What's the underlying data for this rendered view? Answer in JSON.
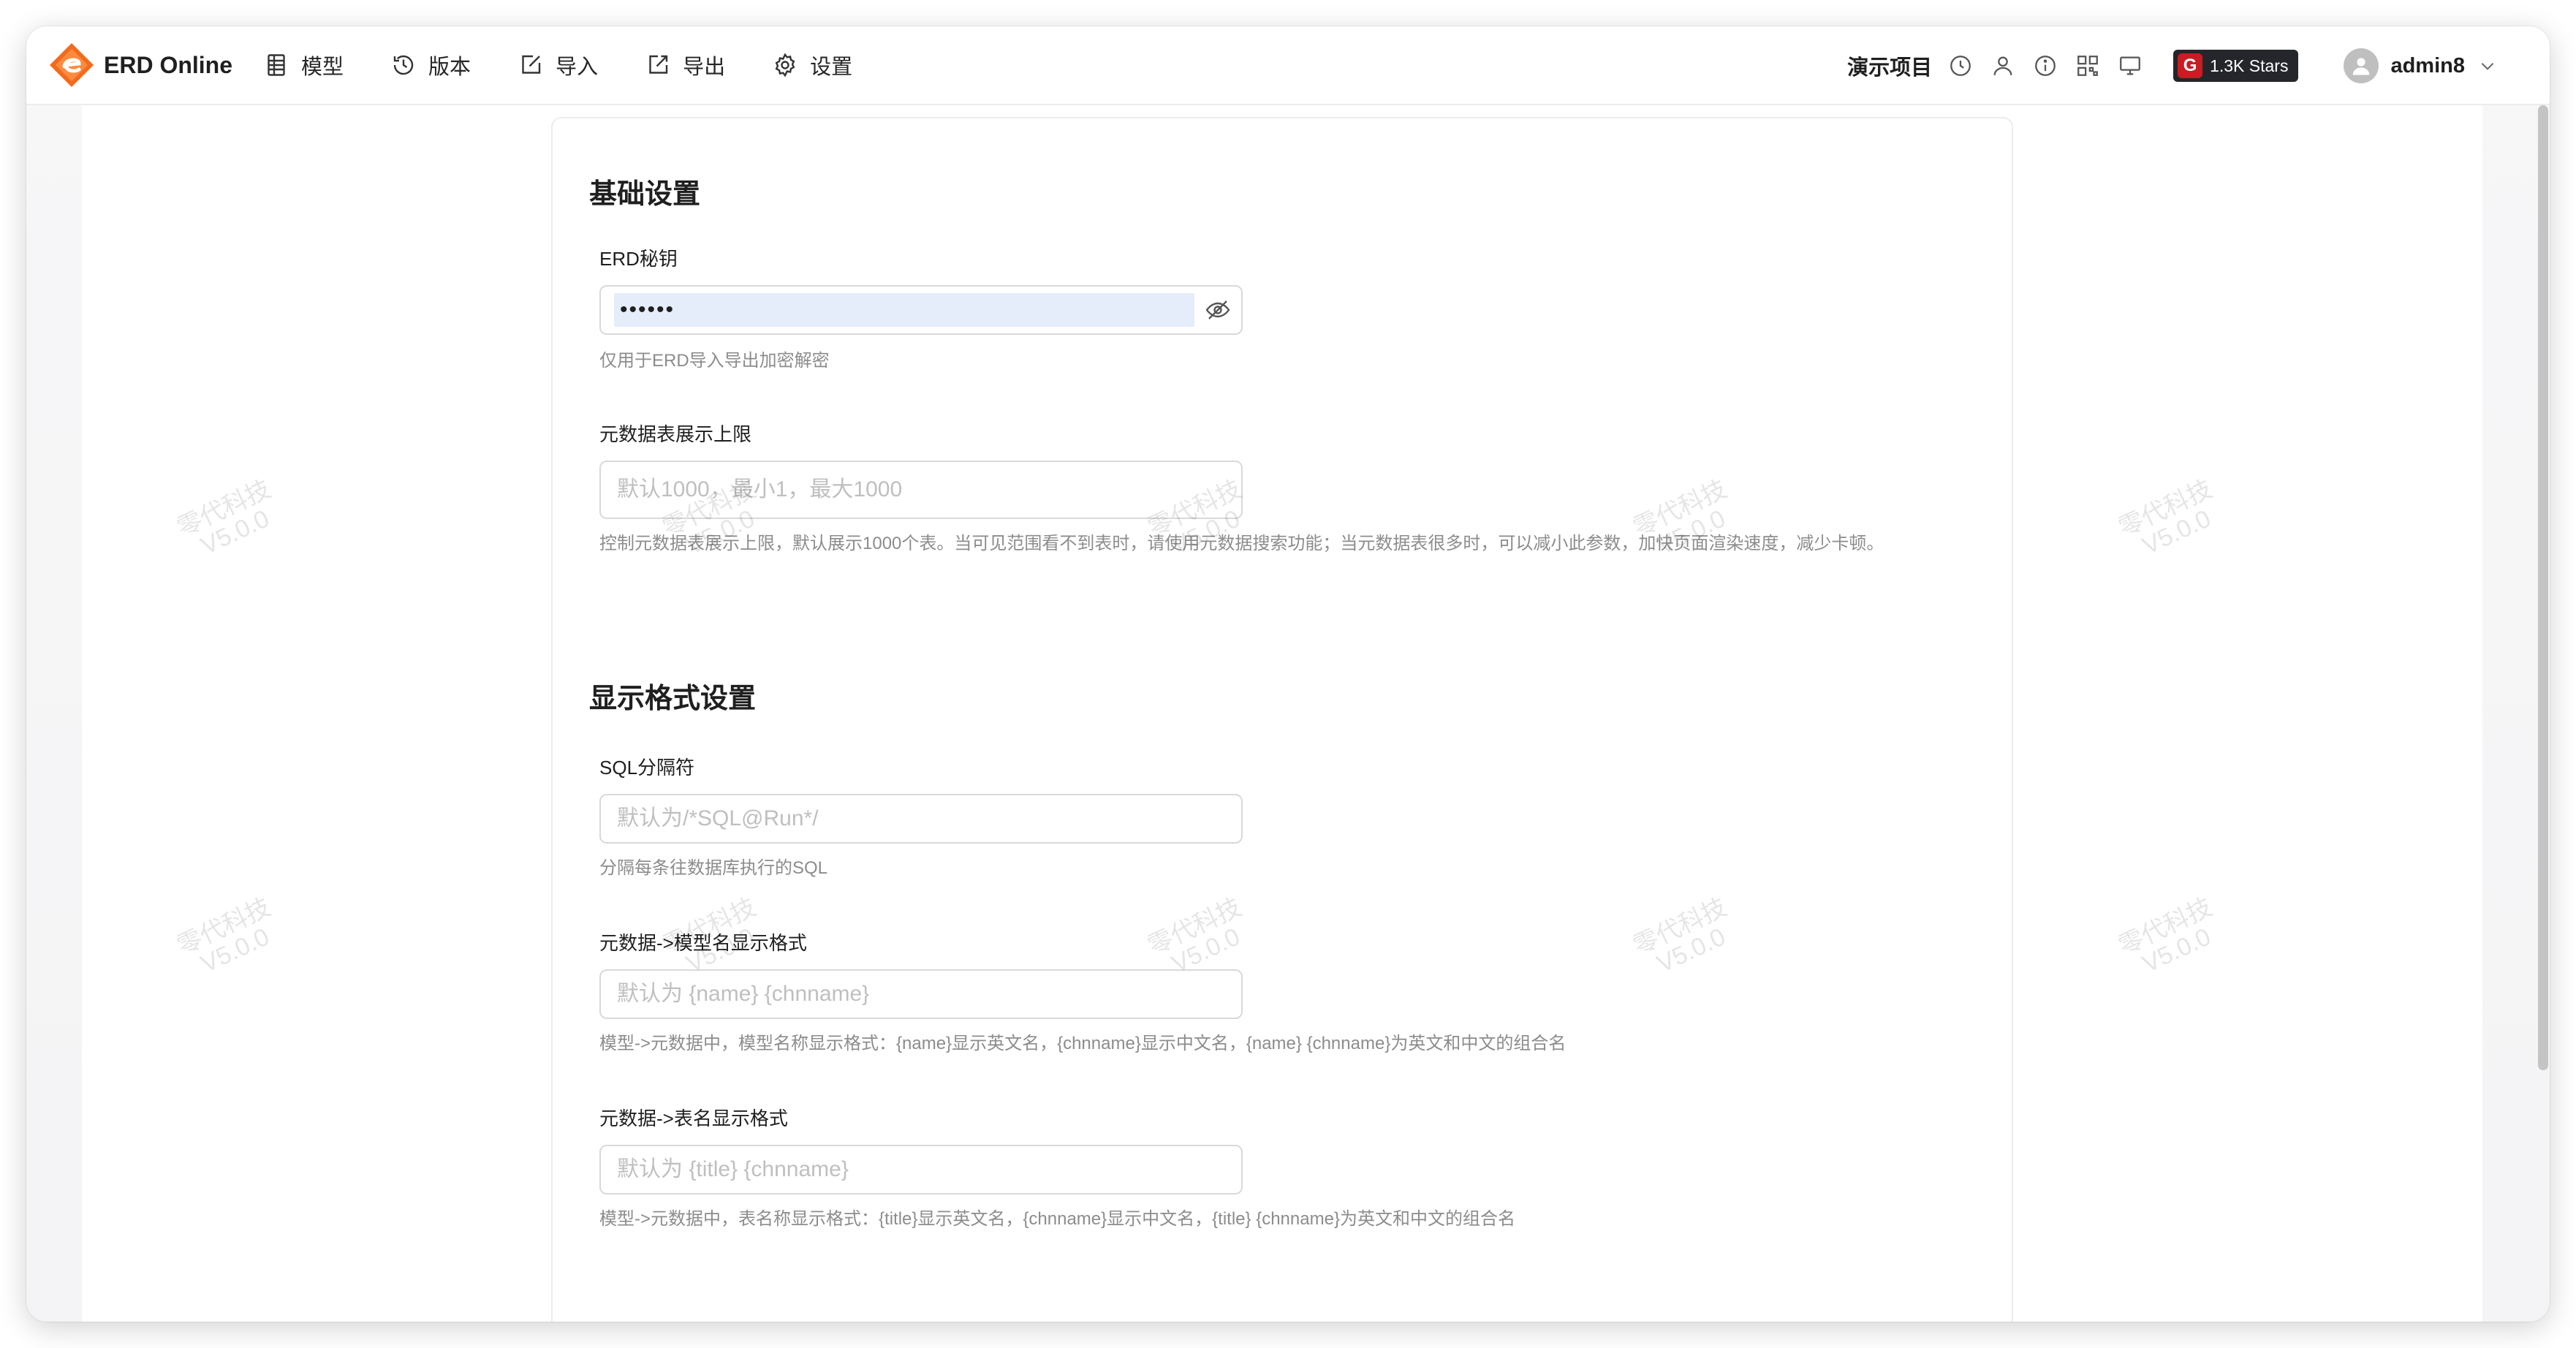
{
  "app": {
    "name": "ERD Online",
    "colors": {
      "brand_orange": "#f26b1d",
      "star_badge": "#25262b",
      "gitee_red": "#c71d23",
      "autofill_blue": "#e5edfb"
    }
  },
  "nav": {
    "items": [
      {
        "label": "模型",
        "icon": "table-icon"
      },
      {
        "label": "版本",
        "icon": "history-icon"
      },
      {
        "label": "导入",
        "icon": "import-icon"
      },
      {
        "label": "导出",
        "icon": "export-icon"
      },
      {
        "label": "设置",
        "icon": "gear-icon"
      }
    ]
  },
  "header_right": {
    "project_name": "演示项目",
    "icons": [
      "clock-icon",
      "user-icon",
      "info-icon",
      "qrcode-icon",
      "desktop-icon"
    ],
    "stars_badge": "1.3K Stars",
    "gitee_letter": "G",
    "username": "admin8"
  },
  "settings": {
    "basic_title": "基础设置",
    "erd_key": {
      "label": "ERD秘钥",
      "value": "••••••",
      "help": "仅用于ERD导入导出加密解密"
    },
    "meta_limit": {
      "label": "元数据表展示上限",
      "placeholder": "默认1000，最小1，最大1000",
      "help": "控制元数据表展示上限，默认展示1000个表。当可见范围看不到表时，请使用元数据搜索功能；当元数据表很多时，可以减小此参数，加快页面渲染速度，减少卡顿。"
    },
    "display_title": "显示格式设置",
    "sql_separator": {
      "label": "SQL分隔符",
      "placeholder": "默认为/*SQL@Run*/",
      "help": "分隔每条往数据库执行的SQL"
    },
    "model_name_format": {
      "label": "元数据->模型名显示格式",
      "placeholder": "默认为 {name} {chnname}",
      "help": "模型->元数据中，模型名称显示格式：{name}显示英文名，{chnname}显示中文名，{name} {chnname}为英文和中文的组合名"
    },
    "table_name_format": {
      "label": "元数据->表名显示格式",
      "placeholder": "默认为 {title} {chnname}",
      "help": "模型->元数据中，表名称显示格式：{title}显示英文名，{chnname}显示中文名，{title} {chnname}为英文和中文的组合名"
    }
  },
  "watermark": {
    "line1": "零代科技",
    "line2": "V5.0.0"
  }
}
